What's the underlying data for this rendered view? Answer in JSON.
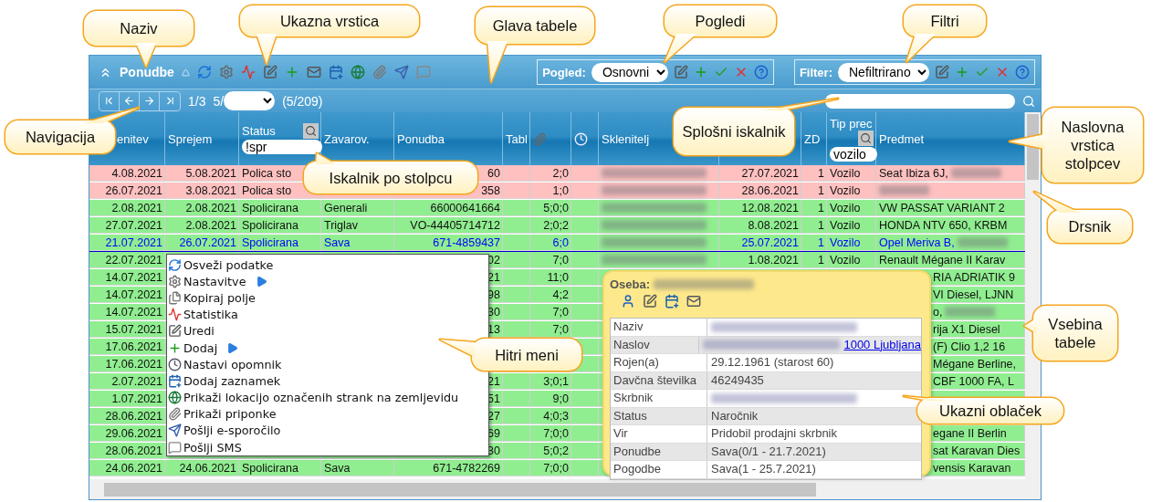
{
  "toolbar": {
    "title": "Ponudbe"
  },
  "view": {
    "label": "Pogled:",
    "value": "Osnovni"
  },
  "filter": {
    "label": "Filter:",
    "value": "Nefiltrirano"
  },
  "navigation": {
    "page": "1/3",
    "per_page_label": "5/",
    "count": "(5/209)"
  },
  "columns": [
    {
      "kind": "text",
      "label": "enitev"
    },
    {
      "kind": "text",
      "label": "Sprejem"
    },
    {
      "kind": "text",
      "label": "Status",
      "filter": "!spr"
    },
    {
      "kind": "text",
      "label": "Zavarov."
    },
    {
      "kind": "text",
      "label": "Ponudba"
    },
    {
      "kind": "text",
      "label": "Tabl"
    },
    {
      "kind": "attachments"
    },
    {
      "kind": "reminders"
    },
    {
      "kind": "text",
      "label": "Sklenitelj"
    },
    {
      "kind": "text"
    },
    {
      "kind": "text",
      "label": "ZD"
    },
    {
      "kind": "text",
      "label": "Tip prec",
      "filter": "vozilo"
    },
    {
      "kind": "text",
      "label": "Predmet"
    }
  ],
  "rows": [
    {
      "color": "#ffc0c0",
      "selected": false,
      "sklenitev": "4.08.2021",
      "sprejem": "5.08.2021",
      "status": "Polica sto",
      "ponudba": "60",
      "column_7": "2;0",
      "client_redacted": true,
      "column_10": "27.07.2021",
      "zd": "1",
      "tip": "Vozilo",
      "predmet": "Seat Ibiza 6J,",
      "subject_redacted": true
    },
    {
      "color": "#ffc0c0",
      "selected": false,
      "sklenitev": "26.07.2021",
      "sprejem": "3.08.2021",
      "status": "Polica sto",
      "ponudba": "358",
      "column_7": "1;0",
      "client_redacted": true,
      "column_10": "28.06.2021",
      "zd": "1",
      "tip": "Vozilo",
      "subject_redacted": true
    },
    {
      "color": "#90ee90",
      "selected": false,
      "sklenitev": "2.08.2021",
      "sprejem": "2.08.2021",
      "status": "Spolicirana",
      "zavarov": "Generali",
      "ponudba": "66000641664",
      "column_7": "5;0;0",
      "client_redacted": true,
      "column_10": "12.08.2021",
      "zd": "1",
      "tip": "Vozilo",
      "predmet": "VW PASSAT VARIANT 2"
    },
    {
      "color": "#90ee90",
      "selected": false,
      "sklenitev": "27.07.2021",
      "sprejem": "2.08.2021",
      "status": "Spolicirana",
      "zavarov": "Triglav",
      "ponudba": "VO-44405714712",
      "column_7": "2;0;2",
      "client_redacted": true,
      "column_10": "8.08.2021",
      "zd": "1",
      "tip": "Vozilo",
      "predmet": "HONDA NTV 650, KRBM"
    },
    {
      "color": "#90ee90",
      "selected": true,
      "sklenitev": "21.07.2021",
      "sprejem": "26.07.2021",
      "status": "Spolicirana",
      "zavarov": "Sava",
      "ponudba": "671-4859437",
      "column_7": "6;0",
      "client_redacted": true,
      "column_10": "25.07.2021",
      "zd": "1",
      "tip": "Vozilo",
      "predmet": "Opel Meriva B,",
      "subject_redacted": true
    },
    {
      "color": "#90ee90",
      "selected": false,
      "sklenitev": "22.07.2021",
      "ponudba": "02",
      "column_7": "7;0",
      "client_redacted": true,
      "column_10": "1.08.2021",
      "zd": "1",
      "tip": "Vozilo",
      "predmet": "Renault Mégane II Karav"
    },
    {
      "color": "#90ee90",
      "selected": false,
      "sklenitev": "14.07.2021",
      "ponudba": "21",
      "column_7": "11;0",
      "predmet": "RIA ADRIATIK 9"
    },
    {
      "color": "#90ee90",
      "selected": false,
      "sklenitev": "14.07.2021",
      "ponudba": "98",
      "column_7": "4;2",
      "predmet": "VI Diesel, LJNN"
    },
    {
      "color": "#90ee90",
      "selected": false,
      "sklenitev": "14.07.2021",
      "ponudba": "30",
      "column_7": "7;0",
      "predmet": "o,",
      "subject_redacted": true
    },
    {
      "color": "#90ee90",
      "selected": false,
      "sklenitev": "15.07.2021",
      "ponudba": "13",
      "column_7": "7;0",
      "predmet": "rija X1 Diesel"
    },
    {
      "color": "#90ee90",
      "selected": false,
      "sklenitev": "17.06.2021",
      "predmet": "(F) Clio 1,2 16"
    },
    {
      "color": "#90ee90",
      "selected": false,
      "sklenitev": "17.06.2021",
      "predmet": "Mégane Berline,"
    },
    {
      "color": "#90ee90",
      "selected": false,
      "sklenitev": "2.07.2021",
      "ponudba": "21",
      "column_7": "3;0;1",
      "predmet": "CBF 1000 FA, L"
    },
    {
      "color": "#90ee90",
      "selected": false,
      "sklenitev": "1.07.2021",
      "ponudba": "51",
      "column_7": "9;0"
    },
    {
      "color": "#90ee90",
      "selected": false,
      "sklenitev": "28.06.2021",
      "ponudba": "27",
      "column_7": "4;0;3"
    },
    {
      "color": "#90ee90",
      "selected": false,
      "sklenitev": "29.06.2021",
      "ponudba": "69",
      "column_7": "7;0;0",
      "predmet": "egane II Berlin"
    },
    {
      "color": "#90ee90",
      "selected": false,
      "sklenitev": "28.06.2021",
      "ponudba": "30",
      "column_7": "5;0;2",
      "predmet": "sat Karavan Dies"
    },
    {
      "color": "#90ee90",
      "selected": false,
      "sklenitev": "24.06.2021",
      "sprejem": "24.06.2021",
      "status": "Spolicirana",
      "zavarov": "Sava",
      "ponudba": "671-4782269",
      "column_7": "7;0;0",
      "predmet": "vensis Karavan"
    }
  ],
  "context_menu": {
    "items": [
      {
        "label": "Osveži podatke",
        "submenu": false
      },
      {
        "label": "Nastavitve",
        "submenu": true
      },
      {
        "label": "Kopiraj polje",
        "submenu": false
      },
      {
        "label": "Statistika",
        "submenu": false
      },
      {
        "label": "Uredi",
        "submenu": false
      },
      {
        "label": "Dodaj",
        "submenu": true
      },
      {
        "label": "Nastavi opomnik",
        "submenu": false
      },
      {
        "label": "Dodaj zaznamek",
        "submenu": false
      },
      {
        "label": "Prikaži lokacijo označenih strank na zemljevidu",
        "submenu": false
      },
      {
        "label": "Prikaži priponke",
        "submenu": false
      },
      {
        "label": "Pošlji e-sporočilo",
        "submenu": false
      },
      {
        "label": "Pošlji SMS",
        "submenu": false
      }
    ]
  },
  "tooltip": {
    "title": "Oseba:",
    "title_redacted": true,
    "rows": [
      {
        "label": "Naziv",
        "redacted": true
      },
      {
        "label": "Naslov",
        "redacted": true,
        "link": "1000 Ljubljana"
      },
      {
        "label": "Rojen(a)",
        "value": "29.12.1961 (starost 60)"
      },
      {
        "label": "Davčna številka",
        "value": "46249435"
      },
      {
        "label": "Skrbnik",
        "redacted": true
      },
      {
        "label": "Status",
        "value": "Naročnik"
      },
      {
        "label": "Vir",
        "value": "Pridobil prodajni skrbnik"
      },
      {
        "label": "Ponudbe",
        "value": "Sava(0/1 - 21.7.2021)"
      },
      {
        "label": "Pogodbe",
        "value": "Sava(1 - 25.7.2021)"
      }
    ]
  },
  "callouts": [
    {
      "text": "Naziv"
    },
    {
      "text": "Ukazna vrstica"
    },
    {
      "text": "Glava tabele"
    },
    {
      "text": "Pogledi"
    },
    {
      "text": "Filtri"
    },
    {
      "text": "Navigacija"
    },
    {
      "text": "Splošni iskalnik"
    },
    {
      "text": "Naslovna vrstica stolpcev"
    },
    {
      "text": "Iskalnik po stolpcu"
    },
    {
      "text": "Drsnik"
    },
    {
      "text": "Hitri meni"
    },
    {
      "text": "Vsebina tabele"
    },
    {
      "text": "Ukazni oblaček"
    }
  ]
}
